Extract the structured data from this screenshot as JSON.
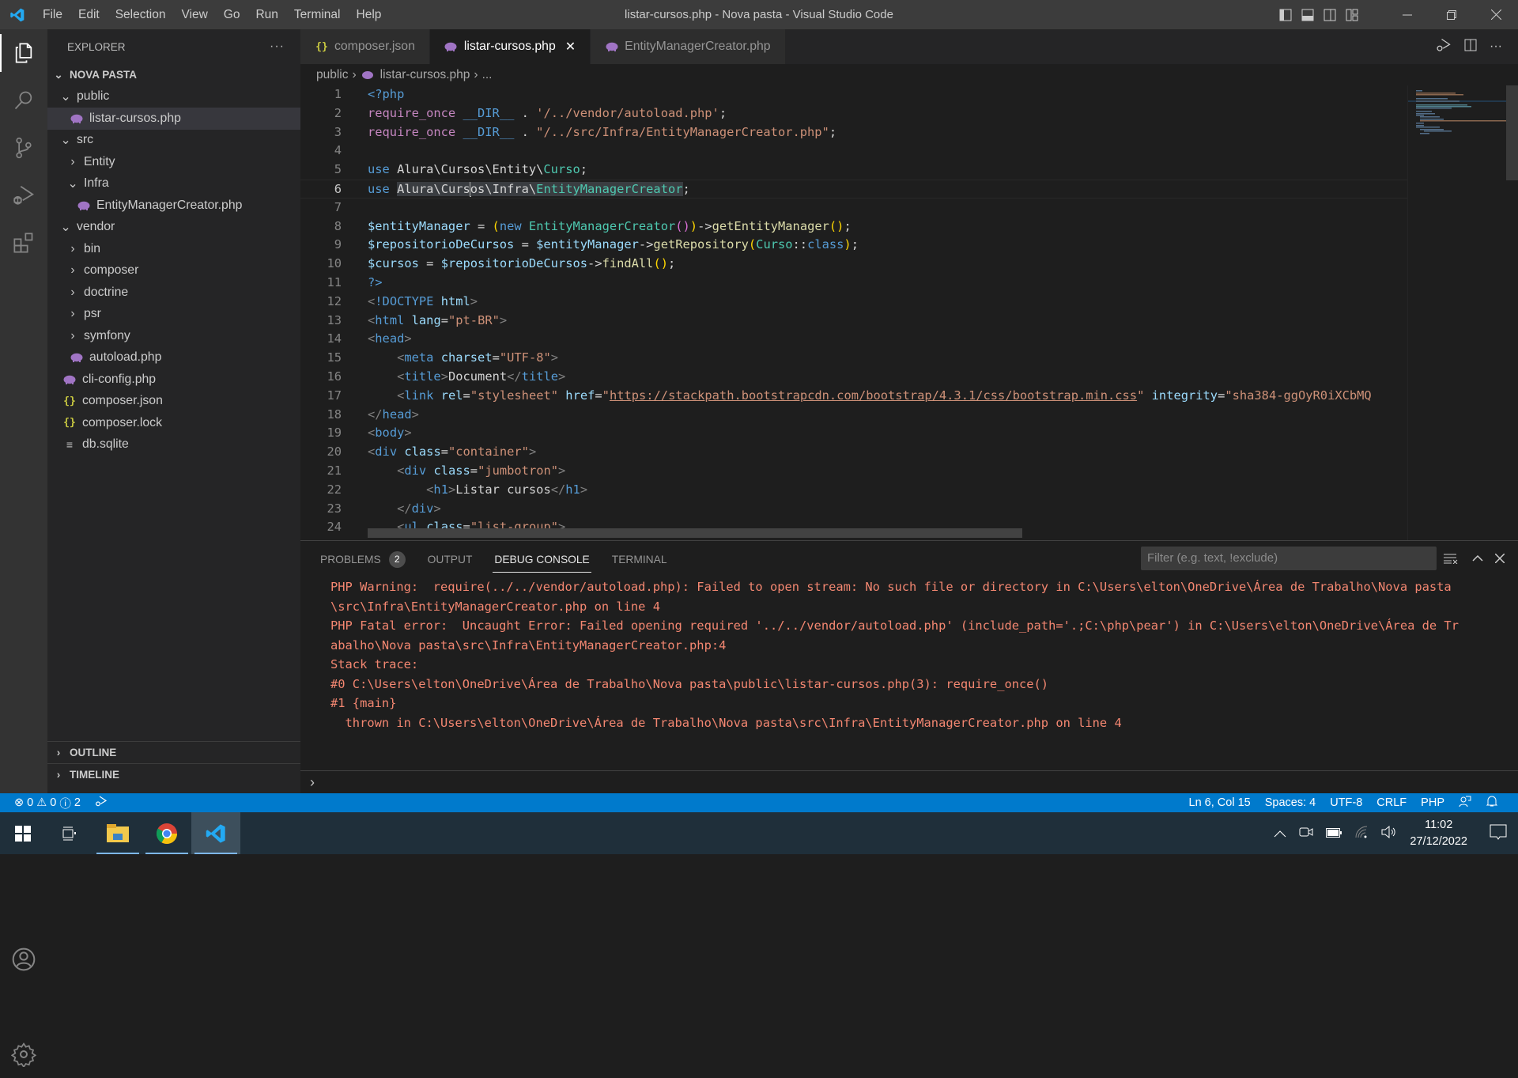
{
  "window": {
    "title": "listar-cursos.php - Nova pasta - Visual Studio Code",
    "menu": [
      "File",
      "Edit",
      "Selection",
      "View",
      "Go",
      "Run",
      "Terminal",
      "Help"
    ],
    "controls": {
      "minimize": "minimize-icon",
      "restore": "restore-icon",
      "close": "close-icon"
    }
  },
  "activity_bar": {
    "items": [
      "explorer",
      "search",
      "source-control",
      "run-and-debug",
      "extensions"
    ],
    "bottom": [
      "accounts",
      "manage"
    ]
  },
  "sidebar": {
    "title": "EXPLORER",
    "more": "···",
    "root": "NOVA PASTA",
    "tree": [
      {
        "label": "public",
        "type": "folder",
        "expanded": true,
        "depth": 1
      },
      {
        "label": "listar-cursos.php",
        "type": "php",
        "depth": 2,
        "selected": true
      },
      {
        "label": "src",
        "type": "folder",
        "expanded": true,
        "depth": 1
      },
      {
        "label": "Entity",
        "type": "folder",
        "expanded": false,
        "depth": 2
      },
      {
        "label": "Infra",
        "type": "folder",
        "expanded": true,
        "depth": 2
      },
      {
        "label": "EntityManagerCreator.php",
        "type": "php",
        "depth": 3
      },
      {
        "label": "vendor",
        "type": "folder",
        "expanded": true,
        "depth": 1
      },
      {
        "label": "bin",
        "type": "folder",
        "expanded": false,
        "depth": 2
      },
      {
        "label": "composer",
        "type": "folder",
        "expanded": false,
        "depth": 2
      },
      {
        "label": "doctrine",
        "type": "folder",
        "expanded": false,
        "depth": 2
      },
      {
        "label": "psr",
        "type": "folder",
        "expanded": false,
        "depth": 2
      },
      {
        "label": "symfony",
        "type": "folder",
        "expanded": false,
        "depth": 2
      },
      {
        "label": "autoload.php",
        "type": "php",
        "depth": 2
      },
      {
        "label": "cli-config.php",
        "type": "php",
        "depth": 1
      },
      {
        "label": "composer.json",
        "type": "json",
        "depth": 1
      },
      {
        "label": "composer.lock",
        "type": "json",
        "depth": 1
      },
      {
        "label": "db.sqlite",
        "type": "text",
        "depth": 1
      }
    ],
    "outline": "OUTLINE",
    "timeline": "TIMELINE"
  },
  "tabs": [
    {
      "label": "composer.json",
      "type": "json",
      "active": false
    },
    {
      "label": "listar-cursos.php",
      "type": "php",
      "active": true,
      "close": "✕"
    },
    {
      "label": "EntityManagerCreator.php",
      "type": "php",
      "active": false
    }
  ],
  "breadcrumb": [
    "public",
    "listar-cursos.php",
    "..."
  ],
  "editor": {
    "current_line": 6,
    "lines": [
      {
        "n": "1",
        "tokens": [
          [
            "kw",
            "<?php"
          ]
        ]
      },
      {
        "n": "2",
        "tokens": [
          [
            "ctl",
            "require_once"
          ],
          [
            "plain",
            " "
          ],
          [
            "kw",
            "__DIR__"
          ],
          [
            "plain",
            " . "
          ],
          [
            "str",
            "'/../vendor/autoload.php'"
          ],
          [
            "plain",
            ";"
          ]
        ]
      },
      {
        "n": "3",
        "tokens": [
          [
            "ctl",
            "require_once"
          ],
          [
            "plain",
            " "
          ],
          [
            "kw",
            "__DIR__"
          ],
          [
            "plain",
            " . "
          ],
          [
            "str",
            "\"/../src/Infra/EntityManagerCreator.php\""
          ],
          [
            "plain",
            ";"
          ]
        ]
      },
      {
        "n": "4",
        "tokens": []
      },
      {
        "n": "5",
        "tokens": [
          [
            "kw",
            "use"
          ],
          [
            "plain",
            " Alura\\Cursos\\Entity\\"
          ],
          [
            "cls",
            "Curso"
          ],
          [
            "plain",
            ";"
          ]
        ]
      },
      {
        "n": "6",
        "tokens": [
          [
            "kw",
            "use"
          ],
          [
            "plain",
            " "
          ],
          [
            "sel",
            "Alura\\Curs"
          ],
          [
            "caret",
            ""
          ],
          [
            "sel",
            "os\\Infra\\"
          ],
          [
            "selcls",
            "EntityManagerCreator"
          ],
          [
            "plain",
            ";"
          ]
        ]
      },
      {
        "n": "7",
        "tokens": []
      },
      {
        "n": "8",
        "tokens": [
          [
            "var",
            "$entityManager"
          ],
          [
            "plain",
            " = "
          ],
          [
            "brk",
            "("
          ],
          [
            "kw",
            "new"
          ],
          [
            "plain",
            " "
          ],
          [
            "cls",
            "EntityManagerCreator"
          ],
          [
            "brk2",
            "()"
          ],
          [
            "brk",
            ")"
          ],
          [
            "plain",
            "->"
          ],
          [
            "fn",
            "getEntityManager"
          ],
          [
            "brk",
            "()"
          ],
          [
            "plain",
            ";"
          ]
        ]
      },
      {
        "n": "9",
        "tokens": [
          [
            "var",
            "$repositorioDeCursos"
          ],
          [
            "plain",
            " = "
          ],
          [
            "var",
            "$entityManager"
          ],
          [
            "plain",
            "->"
          ],
          [
            "fn",
            "getRepository"
          ],
          [
            "brk",
            "("
          ],
          [
            "cls",
            "Curso"
          ],
          [
            "plain",
            "::"
          ],
          [
            "kw",
            "class"
          ],
          [
            "brk",
            ")"
          ],
          [
            "plain",
            ";"
          ]
        ]
      },
      {
        "n": "10",
        "tokens": [
          [
            "var",
            "$cursos"
          ],
          [
            "plain",
            " = "
          ],
          [
            "var",
            "$repositorioDeCursos"
          ],
          [
            "plain",
            "->"
          ],
          [
            "fn",
            "findAll"
          ],
          [
            "brk",
            "()"
          ],
          [
            "plain",
            ";"
          ]
        ]
      },
      {
        "n": "11",
        "tokens": [
          [
            "kw",
            "?>"
          ]
        ]
      },
      {
        "n": "12",
        "tokens": [
          [
            "punc",
            "<"
          ],
          [
            "kw",
            "!DOCTYPE"
          ],
          [
            "plain",
            " "
          ],
          [
            "attr",
            "html"
          ],
          [
            "punc",
            ">"
          ]
        ]
      },
      {
        "n": "13",
        "tokens": [
          [
            "punc",
            "<"
          ],
          [
            "tag",
            "html"
          ],
          [
            "plain",
            " "
          ],
          [
            "attr",
            "lang"
          ],
          [
            "plain",
            "="
          ],
          [
            "str",
            "\"pt-BR\""
          ],
          [
            "punc",
            ">"
          ]
        ]
      },
      {
        "n": "14",
        "tokens": [
          [
            "punc",
            "<"
          ],
          [
            "tag",
            "head"
          ],
          [
            "punc",
            ">"
          ]
        ]
      },
      {
        "n": "15",
        "tokens": [
          [
            "plain",
            "    "
          ],
          [
            "punc",
            "<"
          ],
          [
            "tag",
            "meta"
          ],
          [
            "plain",
            " "
          ],
          [
            "attr",
            "charset"
          ],
          [
            "plain",
            "="
          ],
          [
            "str",
            "\"UTF-8\""
          ],
          [
            "punc",
            ">"
          ]
        ]
      },
      {
        "n": "16",
        "tokens": [
          [
            "plain",
            "    "
          ],
          [
            "punc",
            "<"
          ],
          [
            "tag",
            "title"
          ],
          [
            "punc",
            ">"
          ],
          [
            "plain",
            "Document"
          ],
          [
            "punc",
            "</"
          ],
          [
            "tag",
            "title"
          ],
          [
            "punc",
            ">"
          ]
        ]
      },
      {
        "n": "17",
        "tokens": [
          [
            "plain",
            "    "
          ],
          [
            "punc",
            "<"
          ],
          [
            "tag",
            "link"
          ],
          [
            "plain",
            " "
          ],
          [
            "attr",
            "rel"
          ],
          [
            "plain",
            "="
          ],
          [
            "str",
            "\"stylesheet\""
          ],
          [
            "plain",
            " "
          ],
          [
            "attr",
            "href"
          ],
          [
            "plain",
            "="
          ],
          [
            "str",
            "\""
          ],
          [
            "url",
            "https://stackpath.bootstrapcdn.com/bootstrap/4.3.1/css/bootstrap.min.css"
          ],
          [
            "str",
            "\""
          ],
          [
            "plain",
            " "
          ],
          [
            "attr",
            "integrity"
          ],
          [
            "plain",
            "="
          ],
          [
            "str",
            "\"sha384-ggOyR0iXCbMQ"
          ]
        ]
      },
      {
        "n": "18",
        "tokens": [
          [
            "punc",
            "</"
          ],
          [
            "tag",
            "head"
          ],
          [
            "punc",
            ">"
          ]
        ]
      },
      {
        "n": "19",
        "tokens": [
          [
            "punc",
            "<"
          ],
          [
            "tag",
            "body"
          ],
          [
            "punc",
            ">"
          ]
        ]
      },
      {
        "n": "20",
        "tokens": [
          [
            "punc",
            "<"
          ],
          [
            "tag",
            "div"
          ],
          [
            "plain",
            " "
          ],
          [
            "attr",
            "class"
          ],
          [
            "plain",
            "="
          ],
          [
            "str",
            "\"container\""
          ],
          [
            "punc",
            ">"
          ]
        ]
      },
      {
        "n": "21",
        "tokens": [
          [
            "plain",
            "    "
          ],
          [
            "punc",
            "<"
          ],
          [
            "tag",
            "div"
          ],
          [
            "plain",
            " "
          ],
          [
            "attr",
            "class"
          ],
          [
            "plain",
            "="
          ],
          [
            "str",
            "\"jumbotron\""
          ],
          [
            "punc",
            ">"
          ]
        ]
      },
      {
        "n": "22",
        "tokens": [
          [
            "plain",
            "        "
          ],
          [
            "punc",
            "<"
          ],
          [
            "tag",
            "h1"
          ],
          [
            "punc",
            ">"
          ],
          [
            "plain",
            "Listar cursos"
          ],
          [
            "punc",
            "</"
          ],
          [
            "tag",
            "h1"
          ],
          [
            "punc",
            ">"
          ]
        ]
      },
      {
        "n": "23",
        "tokens": [
          [
            "plain",
            "    "
          ],
          [
            "punc",
            "</"
          ],
          [
            "tag",
            "div"
          ],
          [
            "punc",
            ">"
          ]
        ]
      },
      {
        "n": "24",
        "tokens": [
          [
            "plain",
            "    "
          ],
          [
            "punc",
            "<"
          ],
          [
            "tag",
            "ul"
          ],
          [
            "plain",
            " "
          ],
          [
            "attr",
            "class"
          ],
          [
            "plain",
            "="
          ],
          [
            "str",
            "\"list-group\""
          ],
          [
            "punc",
            ">"
          ]
        ]
      }
    ]
  },
  "panel": {
    "tabs": [
      {
        "label": "PROBLEMS",
        "badge": "2",
        "active": false
      },
      {
        "label": "OUTPUT",
        "active": false
      },
      {
        "label": "DEBUG CONSOLE",
        "active": true
      },
      {
        "label": "TERMINAL",
        "active": false
      }
    ],
    "filter_placeholder": "Filter (e.g. text, !exclude)",
    "console_lines": [
      "PHP Warning:  require(../../vendor/autoload.php): Failed to open stream: No such file or directory in C:\\Users\\elton\\OneDrive\\Área de Trabalho\\Nova pasta",
      "\\src\\Infra\\EntityManagerCreator.php on line 4",
      "PHP Fatal error:  Uncaught Error: Failed opening required '../../vendor/autoload.php' (include_path='.;C:\\php\\pear') in C:\\Users\\elton\\OneDrive\\Área de Tr",
      "abalho\\Nova pasta\\src\\Infra\\EntityManagerCreator.php:4",
      "Stack trace:",
      "#0 C:\\Users\\elton\\OneDrive\\Área de Trabalho\\Nova pasta\\public\\listar-cursos.php(3): require_once()",
      "#1 {main}",
      "  thrown in C:\\Users\\elton\\OneDrive\\Área de Trabalho\\Nova pasta\\src\\Infra\\EntityManagerCreator.php on line 4"
    ],
    "repl_prompt": "›"
  },
  "statusbar": {
    "errors": "0",
    "warnings": "0",
    "infos": "2",
    "cursor": "Ln 6, Col 15",
    "indent": "Spaces: 4",
    "encoding": "UTF-8",
    "eol": "CRLF",
    "language": "PHP"
  },
  "taskbar": {
    "apps": [
      "start",
      "task-view",
      "file-explorer",
      "chrome",
      "vscode"
    ],
    "time": "11:02",
    "date": "27/12/2022"
  },
  "colors": {
    "accent": "#007acc",
    "error_text": "#f48771",
    "php_icon": "#a074c4",
    "json_icon": "#cbcb41"
  }
}
